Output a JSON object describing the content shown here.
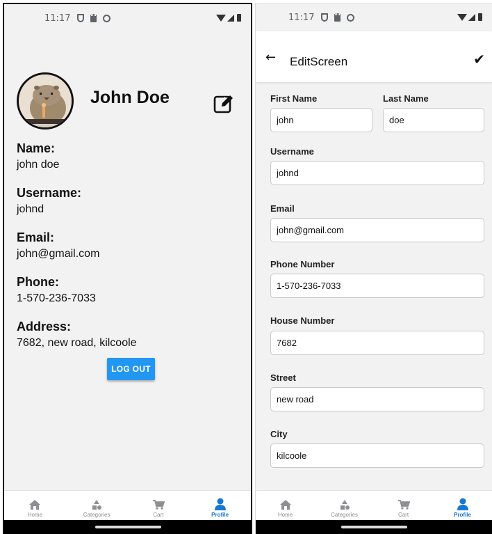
{
  "status": {
    "time": "11:17"
  },
  "profile": {
    "display_name": "John Doe",
    "name_label": "Name:",
    "name_value": "john doe",
    "username_label": "Username:",
    "username_value": "johnd",
    "email_label": "Email:",
    "email_value": "john@gmail.com",
    "phone_label": "Phone:",
    "phone_value": "1-570-236-7033",
    "address_label": "Address:",
    "address_value": "7682, new road, kilcoole",
    "logout_label": "LOG OUT"
  },
  "tabs": [
    {
      "label": "Home",
      "icon": "home-icon"
    },
    {
      "label": "Categories",
      "icon": "categories-icon"
    },
    {
      "label": "Cart",
      "icon": "cart-icon"
    },
    {
      "label": "Profile",
      "icon": "profile-icon",
      "active": true
    }
  ],
  "edit": {
    "title": "EditScreen",
    "first_name_label": "First Name",
    "first_name": "john",
    "last_name_label": "Last Name",
    "last_name": "doe",
    "username_label": "Username",
    "username": "johnd",
    "email_label": "Email",
    "email": "john@gmail.com",
    "phone_label": "Phone Number",
    "phone": "1-570-236-7033",
    "house_label": "House Number",
    "house": "7682",
    "street_label": "Street",
    "street": "new road",
    "city_label": "City",
    "city": "kilcoole"
  },
  "colors": {
    "accent": "#1478d4",
    "logout": "#2196f3",
    "background": "#f2f2f2"
  }
}
